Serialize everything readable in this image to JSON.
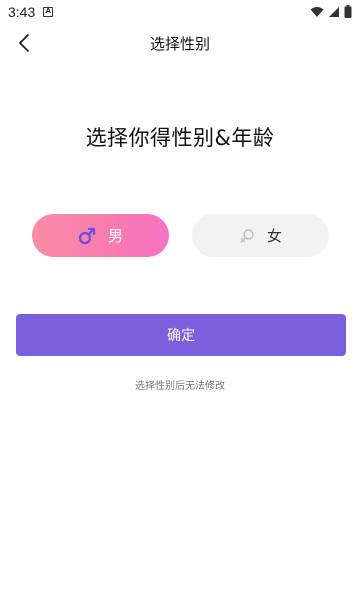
{
  "status_bar": {
    "time": "3:43",
    "notification_badge": "A"
  },
  "header": {
    "title": "选择性别"
  },
  "main": {
    "headline": "选择你得性别&年龄",
    "gender_options": [
      {
        "label": "男",
        "selected": true,
        "icon": "male-symbol-icon"
      },
      {
        "label": "女",
        "selected": false,
        "icon": "female-symbol-icon"
      }
    ],
    "confirm_label": "确定",
    "hint": "选择性别后无法修改"
  },
  "colors": {
    "primary": "#7a60dc",
    "male_gradient_start": "#f98ca5",
    "male_gradient_end": "#f872c3",
    "male_icon": "#6a4ce0",
    "female_bg": "#f2f2f2"
  }
}
